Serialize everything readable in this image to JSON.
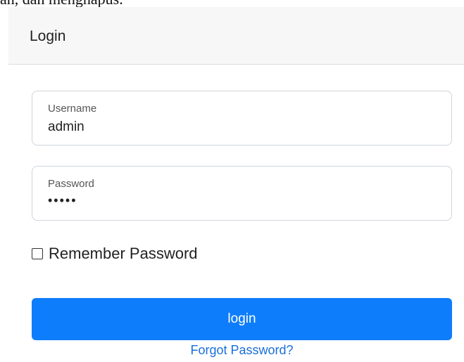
{
  "background_text": "an, dan menghapus.",
  "card": {
    "title": "Login"
  },
  "form": {
    "username": {
      "label": "Username",
      "value": "admin"
    },
    "password": {
      "label": "Password",
      "masked_value": "•••••"
    },
    "remember": {
      "label": "Remember Password",
      "checked": false
    },
    "login_button": "login",
    "forgot_link": "Forgot Password?"
  },
  "colors": {
    "primary": "#0d7dfb",
    "link": "#1a6fd8",
    "header_bg": "#f7f7f7",
    "border": "#cfd4da"
  }
}
